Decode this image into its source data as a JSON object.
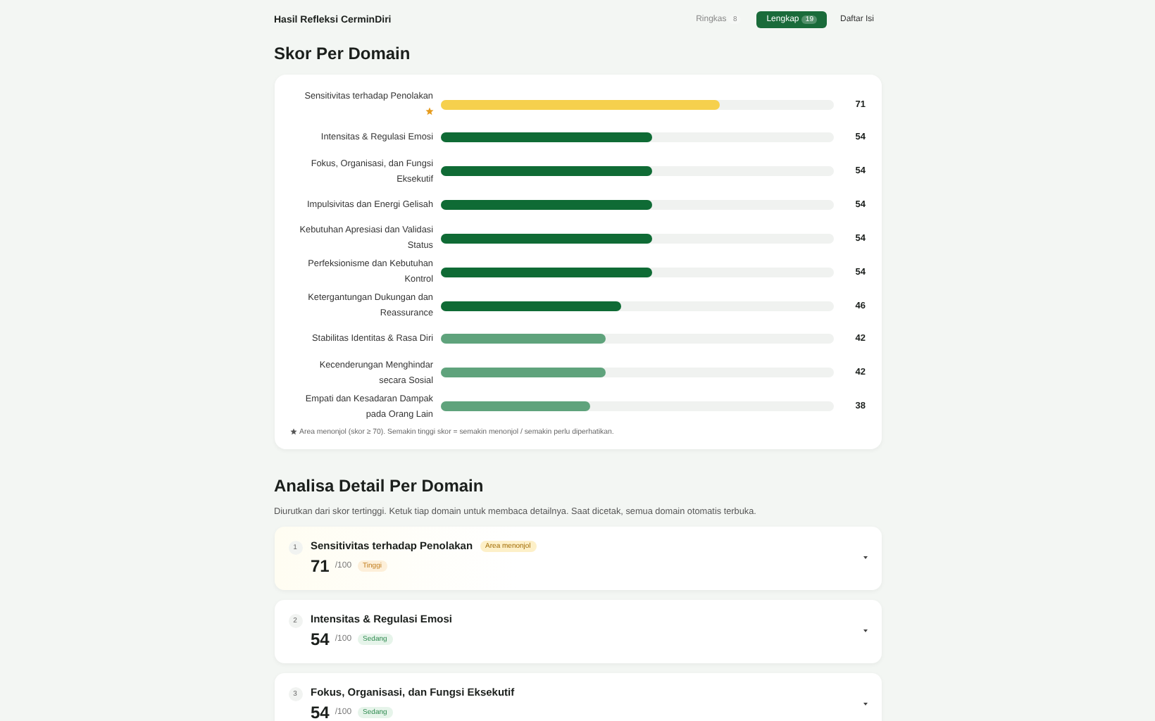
{
  "header": {
    "title": "Hasil Refleksi CerminDiri",
    "view_tabs": [
      {
        "label": "Ringkas",
        "count": "8",
        "selected": false
      },
      {
        "label": "Lengkap",
        "count": "19",
        "selected": true
      }
    ],
    "toc_button": "Daftar Isi"
  },
  "scores": {
    "title": "Skor Per Domain",
    "domains": [
      {
        "name": "Sensitivitas terhadap Penolakan",
        "flagged": true,
        "kind": "highlight",
        "level": 0.71,
        "score": "71"
      },
      {
        "name": "Intensitas & Regulasi Emosi",
        "flagged": false,
        "kind": "high",
        "level": 0.54,
        "score": "54"
      },
      {
        "name": "Fokus, Organisasi, dan Fungsi Eksekutif",
        "flagged": false,
        "kind": "high",
        "level": 0.54,
        "score": "54"
      },
      {
        "name": "Impulsivitas dan Energi Gelisah",
        "flagged": false,
        "kind": "high",
        "level": 0.54,
        "score": "54"
      },
      {
        "name": "Kebutuhan Apresiasi dan Validasi Status",
        "flagged": false,
        "kind": "high",
        "level": 0.54,
        "score": "54"
      },
      {
        "name": "Perfeksionisme dan Kebutuhan Kontrol",
        "flagged": false,
        "kind": "high",
        "level": 0.54,
        "score": "54"
      },
      {
        "name": "Ketergantungan Dukungan dan Reassurance",
        "flagged": false,
        "kind": "high",
        "level": 0.46,
        "score": "46"
      },
      {
        "name": "Stabilitas Identitas & Rasa Diri",
        "flagged": false,
        "kind": "moderate",
        "level": 0.42,
        "score": "42"
      },
      {
        "name": "Kecenderungan Menghindar secara Sosial",
        "flagged": false,
        "kind": "moderate",
        "level": 0.42,
        "score": "42"
      },
      {
        "name": "Empati dan Kesadaran Dampak pada Orang Lain",
        "flagged": false,
        "kind": "moderate",
        "level": 0.38,
        "score": "38"
      }
    ],
    "footnote": "Area menonjol (skor ≥ 70). Semakin tinggi skor = semakin menonjol / semakin perlu diperhatikan."
  },
  "details": {
    "title": "Analisa Detail Per Domain",
    "subtitle": "Diurutkan dari skor tertinggi. Ketuk tiap domain untuk membaca detailnya. Saat dicetak, semua domain otomatis terbuka.",
    "items": [
      {
        "rank": "1",
        "name": "Sensitivitas terhadap Penolakan",
        "flag_badge": "Area menonjol",
        "score": "71",
        "max": "/100",
        "band": "Tinggi",
        "kind": "high"
      },
      {
        "rank": "2",
        "name": "Intensitas & Regulasi Emosi",
        "score": "54",
        "max": "/100",
        "band": "Sedang",
        "kind": "medium"
      },
      {
        "rank": "3",
        "name": "Fokus, Organisasi, dan Fungsi Eksekutif",
        "score": "54",
        "max": "/100",
        "band": "Sedang",
        "kind": "medium"
      }
    ]
  }
}
